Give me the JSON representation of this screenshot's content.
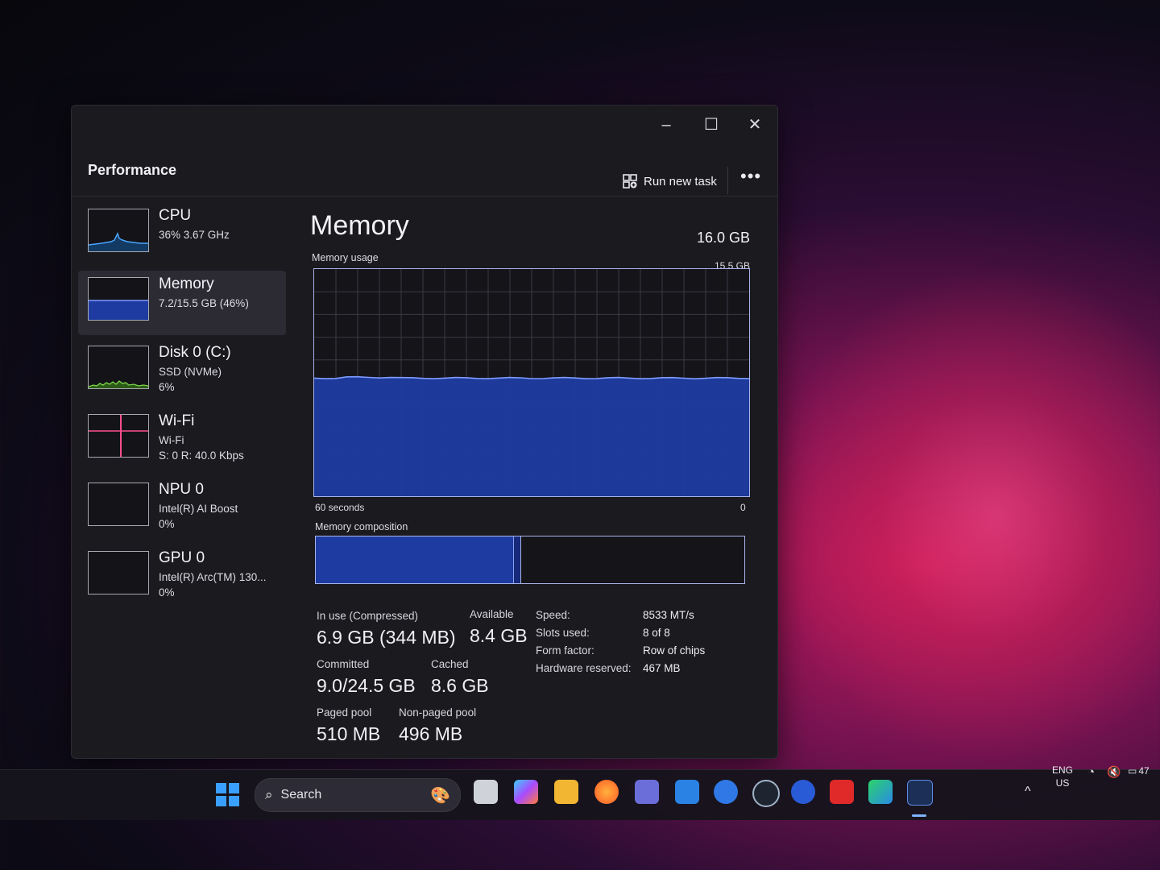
{
  "window": {
    "title": "Performance",
    "controls": {
      "minimize": "–",
      "maximize": "☐",
      "close": "✕"
    },
    "run_new_task": "Run new task",
    "more": "•••"
  },
  "sidebar": {
    "items": [
      {
        "title": "CPU",
        "line1": "36% 3.67 GHz",
        "line2": "",
        "graph_color": "#4aa6ff"
      },
      {
        "title": "Memory",
        "line1": "7.2/15.5 GB (46%)",
        "line2": "",
        "graph_color": "#2a56d8"
      },
      {
        "title": "Disk 0 (C:)",
        "line1": "SSD (NVMe)",
        "line2": "6%",
        "graph_color": "#7bd84a"
      },
      {
        "title": "Wi-Fi",
        "line1": "Wi-Fi",
        "line2": "S: 0 R: 40.0 Kbps",
        "graph_color": "#ff4f8c"
      },
      {
        "title": "NPU 0",
        "line1": "Intel(R) AI Boost",
        "line2": "0%",
        "graph_color": "#7a7a80"
      },
      {
        "title": "GPU 0",
        "line1": "Intel(R) Arc(TM) 130...",
        "line2": "0%",
        "graph_color": "#7a7a80"
      }
    ]
  },
  "memory": {
    "title": "Memory",
    "total": "16.0 GB",
    "usage_label": "Memory usage",
    "usage_max": "15.5 GB",
    "axis_left": "60 seconds",
    "axis_right": "0",
    "composition_label": "Memory composition",
    "usage_fraction": 0.46,
    "composition": {
      "in_use_fraction": 0.46,
      "modified_fraction": 0.015
    },
    "stats": {
      "in_use": {
        "label": "In use (Compressed)",
        "value": "6.9 GB (344 MB)"
      },
      "available": {
        "label": "Available",
        "value": "8.4 GB"
      },
      "committed": {
        "label": "Committed",
        "value": "9.0/24.5 GB"
      },
      "cached": {
        "label": "Cached",
        "value": "8.6 GB"
      },
      "paged_pool": {
        "label": "Paged pool",
        "value": "510 MB"
      },
      "non_paged_pool": {
        "label": "Non-paged pool",
        "value": "496 MB"
      }
    },
    "specs": [
      {
        "key": "Speed:",
        "value": "8533 MT/s"
      },
      {
        "key": "Slots used:",
        "value": "8 of 8"
      },
      {
        "key": "Form factor:",
        "value": "Row of chips"
      },
      {
        "key": "Hardware reserved:",
        "value": "467 MB"
      }
    ],
    "fill_color": "#1d3ba0",
    "line_color": "#7f9cff"
  },
  "taskbar": {
    "search_placeholder": "Search",
    "tray": {
      "lang": "ENG",
      "region": "US",
      "battery": "47"
    },
    "apps": [
      "task-view",
      "copilot",
      "file-explorer",
      "firefox",
      "teams",
      "outlook",
      "app-blue",
      "app-circle",
      "app-ring",
      "app-red",
      "app-play",
      "task-manager"
    ]
  }
}
